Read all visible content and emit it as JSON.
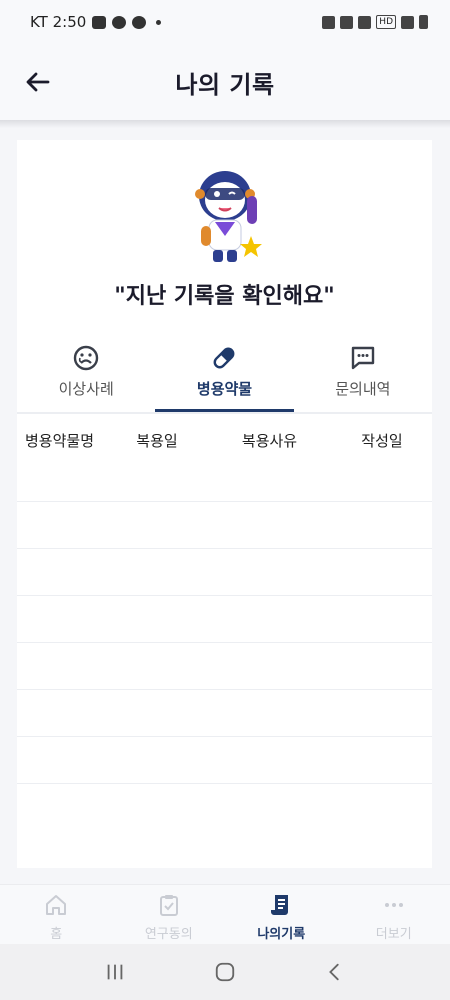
{
  "status_bar": {
    "carrier_time": "KT 2:50",
    "hd_label": "HD"
  },
  "header": {
    "title": "나의 기록",
    "back_icon": "arrow-left-icon"
  },
  "hero": {
    "headline": "\"지난 기록을 확인해요\"",
    "mascot": "mascot-illustration"
  },
  "tabs": [
    {
      "label": "이상사례",
      "icon": "sad-face-icon",
      "active": false
    },
    {
      "label": "병용약물",
      "icon": "pill-icon",
      "active": true
    },
    {
      "label": "문의내역",
      "icon": "chat-bubble-icon",
      "active": false
    }
  ],
  "table": {
    "columns": [
      "병용약물명",
      "복용일",
      "복용사유",
      "작성일"
    ],
    "rows": [
      [],
      [],
      [],
      [],
      [],
      [],
      [],
      []
    ]
  },
  "bottom_nav": [
    {
      "label": "홈",
      "icon": "home-icon",
      "active": false
    },
    {
      "label": "연구동의",
      "icon": "clipboard-check-icon",
      "active": false
    },
    {
      "label": "나의기록",
      "icon": "record-document-icon",
      "active": true
    },
    {
      "label": "더보기",
      "icon": "more-dots-icon",
      "active": false
    }
  ],
  "colors": {
    "accent": "#1f3a6a",
    "inactive": "#c9ccd3",
    "background": "#f5f6f9"
  }
}
